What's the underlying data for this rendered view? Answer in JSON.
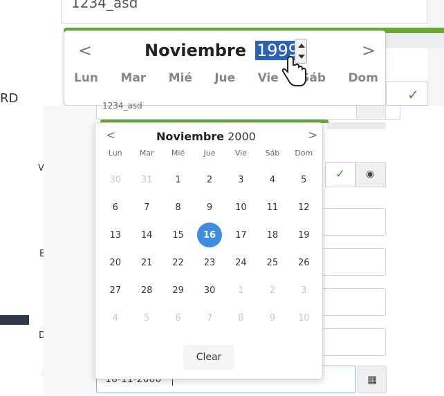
{
  "zoom": {
    "prev_input_value": "1234_asd",
    "month": "Noviembre",
    "year": "1999",
    "prev_symbol": "<",
    "next_symbol": ">",
    "dows": [
      "Lun",
      "Mar",
      "Mié",
      "Jue",
      "Vie",
      "Sáb",
      "Dom"
    ],
    "check_symbol": "✓"
  },
  "labels": {
    "rd": "RD",
    "word": "VORD",
    "e": "E",
    "d": "D",
    "star": "*"
  },
  "form": {
    "top_input_value": "1234_asd",
    "check_symbol": "✓",
    "eye_symbol": "◉",
    "date_value": "16-11-2000",
    "calendar_icon": "▦"
  },
  "picker": {
    "month": "Noviembre",
    "year": "2000",
    "prev_symbol": "<",
    "next_symbol": ">",
    "dows": [
      "Lun",
      "Mar",
      "Mié",
      "Jue",
      "Vie",
      "Sáb",
      "Dom"
    ],
    "weeks": [
      [
        [
          "30",
          true
        ],
        [
          "31",
          true
        ],
        [
          "1",
          false
        ],
        [
          "2",
          false
        ],
        [
          "3",
          false
        ],
        [
          "4",
          false
        ],
        [
          "5",
          false
        ]
      ],
      [
        [
          "6",
          false
        ],
        [
          "7",
          false
        ],
        [
          "8",
          false
        ],
        [
          "9",
          false
        ],
        [
          "10",
          false
        ],
        [
          "11",
          false
        ],
        [
          "12",
          false
        ]
      ],
      [
        [
          "13",
          false
        ],
        [
          "14",
          false
        ],
        [
          "15",
          false
        ],
        [
          "16",
          false
        ],
        [
          "17",
          false
        ],
        [
          "18",
          false
        ],
        [
          "19",
          false
        ]
      ],
      [
        [
          "20",
          false
        ],
        [
          "21",
          false
        ],
        [
          "22",
          false
        ],
        [
          "23",
          false
        ],
        [
          "24",
          false
        ],
        [
          "25",
          false
        ],
        [
          "26",
          false
        ]
      ],
      [
        [
          "27",
          false
        ],
        [
          "28",
          false
        ],
        [
          "29",
          false
        ],
        [
          "30",
          false
        ],
        [
          "1",
          true
        ],
        [
          "2",
          true
        ],
        [
          "3",
          true
        ]
      ],
      [
        [
          "4",
          true
        ],
        [
          "5",
          true
        ],
        [
          "6",
          true
        ],
        [
          "7",
          true
        ],
        [
          "8",
          true
        ],
        [
          "9",
          true
        ],
        [
          "10",
          true
        ]
      ]
    ],
    "selected_day": "16",
    "clear_label": "Clear"
  },
  "colors": {
    "accent_green": "#6aa836",
    "selected_blue": "#3d8ee0",
    "year_highlight": "#2b62b8"
  }
}
